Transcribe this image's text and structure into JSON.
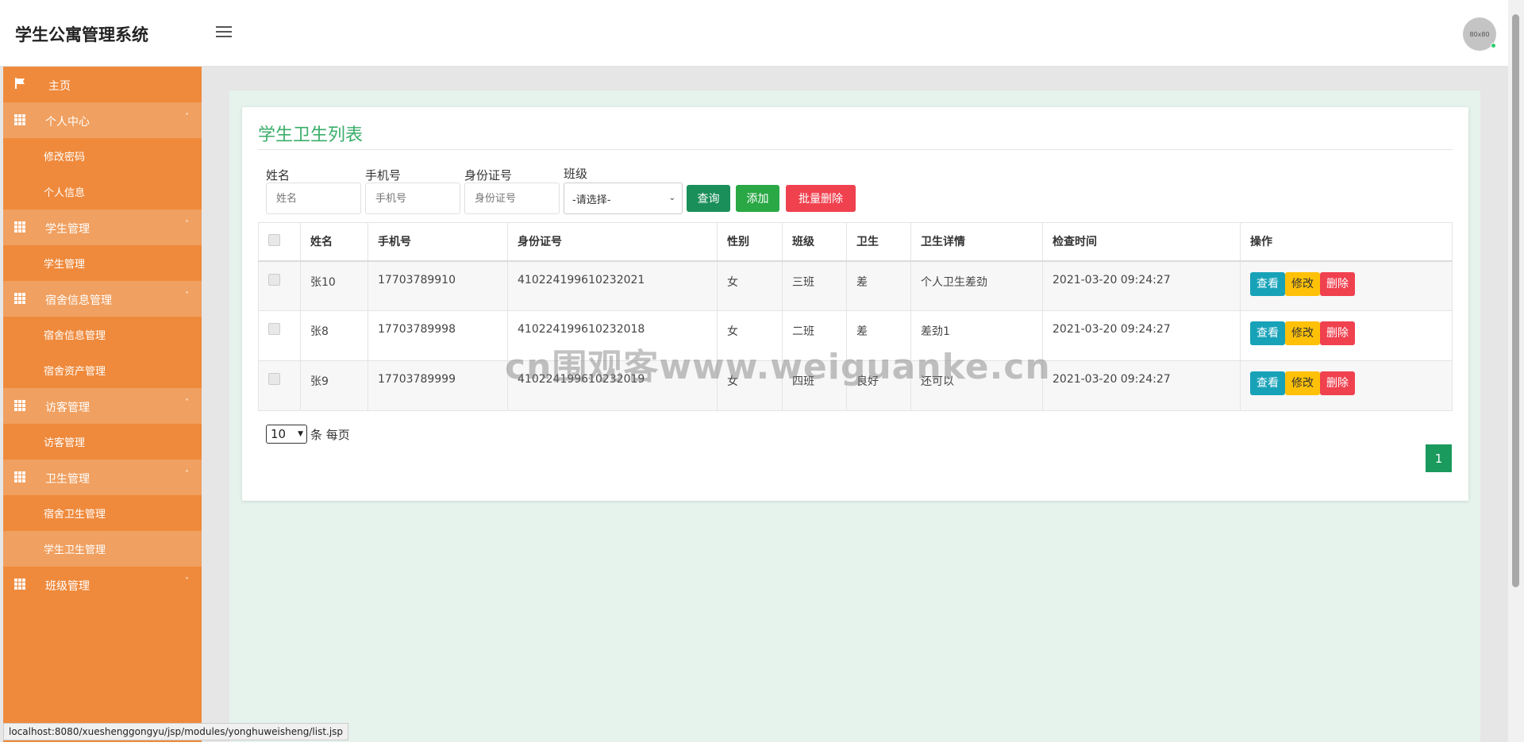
{
  "header": {
    "title": "学生公寓管理系统",
    "avatar_text": "80x80"
  },
  "sidebar": {
    "home": "主页",
    "groups": [
      {
        "label": "个人中心",
        "items": [
          "修改密码",
          "个人信息"
        ]
      },
      {
        "label": "学生管理",
        "items": [
          "学生管理"
        ]
      },
      {
        "label": "宿舍信息管理",
        "items": [
          "宿舍信息管理",
          "宿舍资产管理"
        ]
      },
      {
        "label": "访客管理",
        "items": [
          "访客管理"
        ]
      },
      {
        "label": "卫生管理",
        "items": [
          "宿舍卫生管理",
          "学生卫生管理"
        ]
      },
      {
        "label": "班级管理",
        "items": []
      }
    ],
    "active_item": "学生卫生管理"
  },
  "page": {
    "title": "学生卫生列表",
    "filters": {
      "name_label": "姓名",
      "name_placeholder": "姓名",
      "phone_label": "手机号",
      "phone_placeholder": "手机号",
      "id_label": "身份证号",
      "id_placeholder": "身份证号",
      "class_label": "班级",
      "class_selected": "-请选择-"
    },
    "buttons": {
      "search": "查询",
      "add": "添加",
      "batch_delete": "批量删除"
    },
    "table": {
      "headers": [
        "姓名",
        "手机号",
        "身份证号",
        "性别",
        "班级",
        "卫生",
        "卫生详情",
        "检查时间",
        "操作"
      ],
      "rows": [
        [
          "张10",
          "17703789910",
          "410224199610232021",
          "女",
          "三班",
          "差",
          "个人卫生差劲",
          "2021-03-20 09:24:27"
        ],
        [
          "张8",
          "17703789998",
          "410224199610232018",
          "女",
          "二班",
          "差",
          "差劲1",
          "2021-03-20 09:24:27"
        ],
        [
          "张9",
          "17703789999",
          "410224199610232019",
          "女",
          "四班",
          "良好",
          "还可以",
          "2021-03-20 09:24:27"
        ]
      ],
      "actions": {
        "view": "查看",
        "edit": "修改",
        "delete": "删除"
      }
    },
    "pagination": {
      "page_size": "10",
      "per_page_text": "条 每页",
      "current_page": "1"
    }
  },
  "watermark": "cn围观客www.weiguanke.cn",
  "status_url": "localhost:8080/xueshenggongyu/jsp/modules/yonghuweisheng/list.jsp",
  "colors": {
    "sidebar": "#ef8a3c",
    "sidebar_group": "#f0a060",
    "title_green": "#3aae6a",
    "search_btn": "#1a8f5a",
    "add_btn": "#29a845",
    "delete_btn": "#f0414f",
    "view_btn": "#17a2b8",
    "edit_btn": "#ffc107"
  }
}
